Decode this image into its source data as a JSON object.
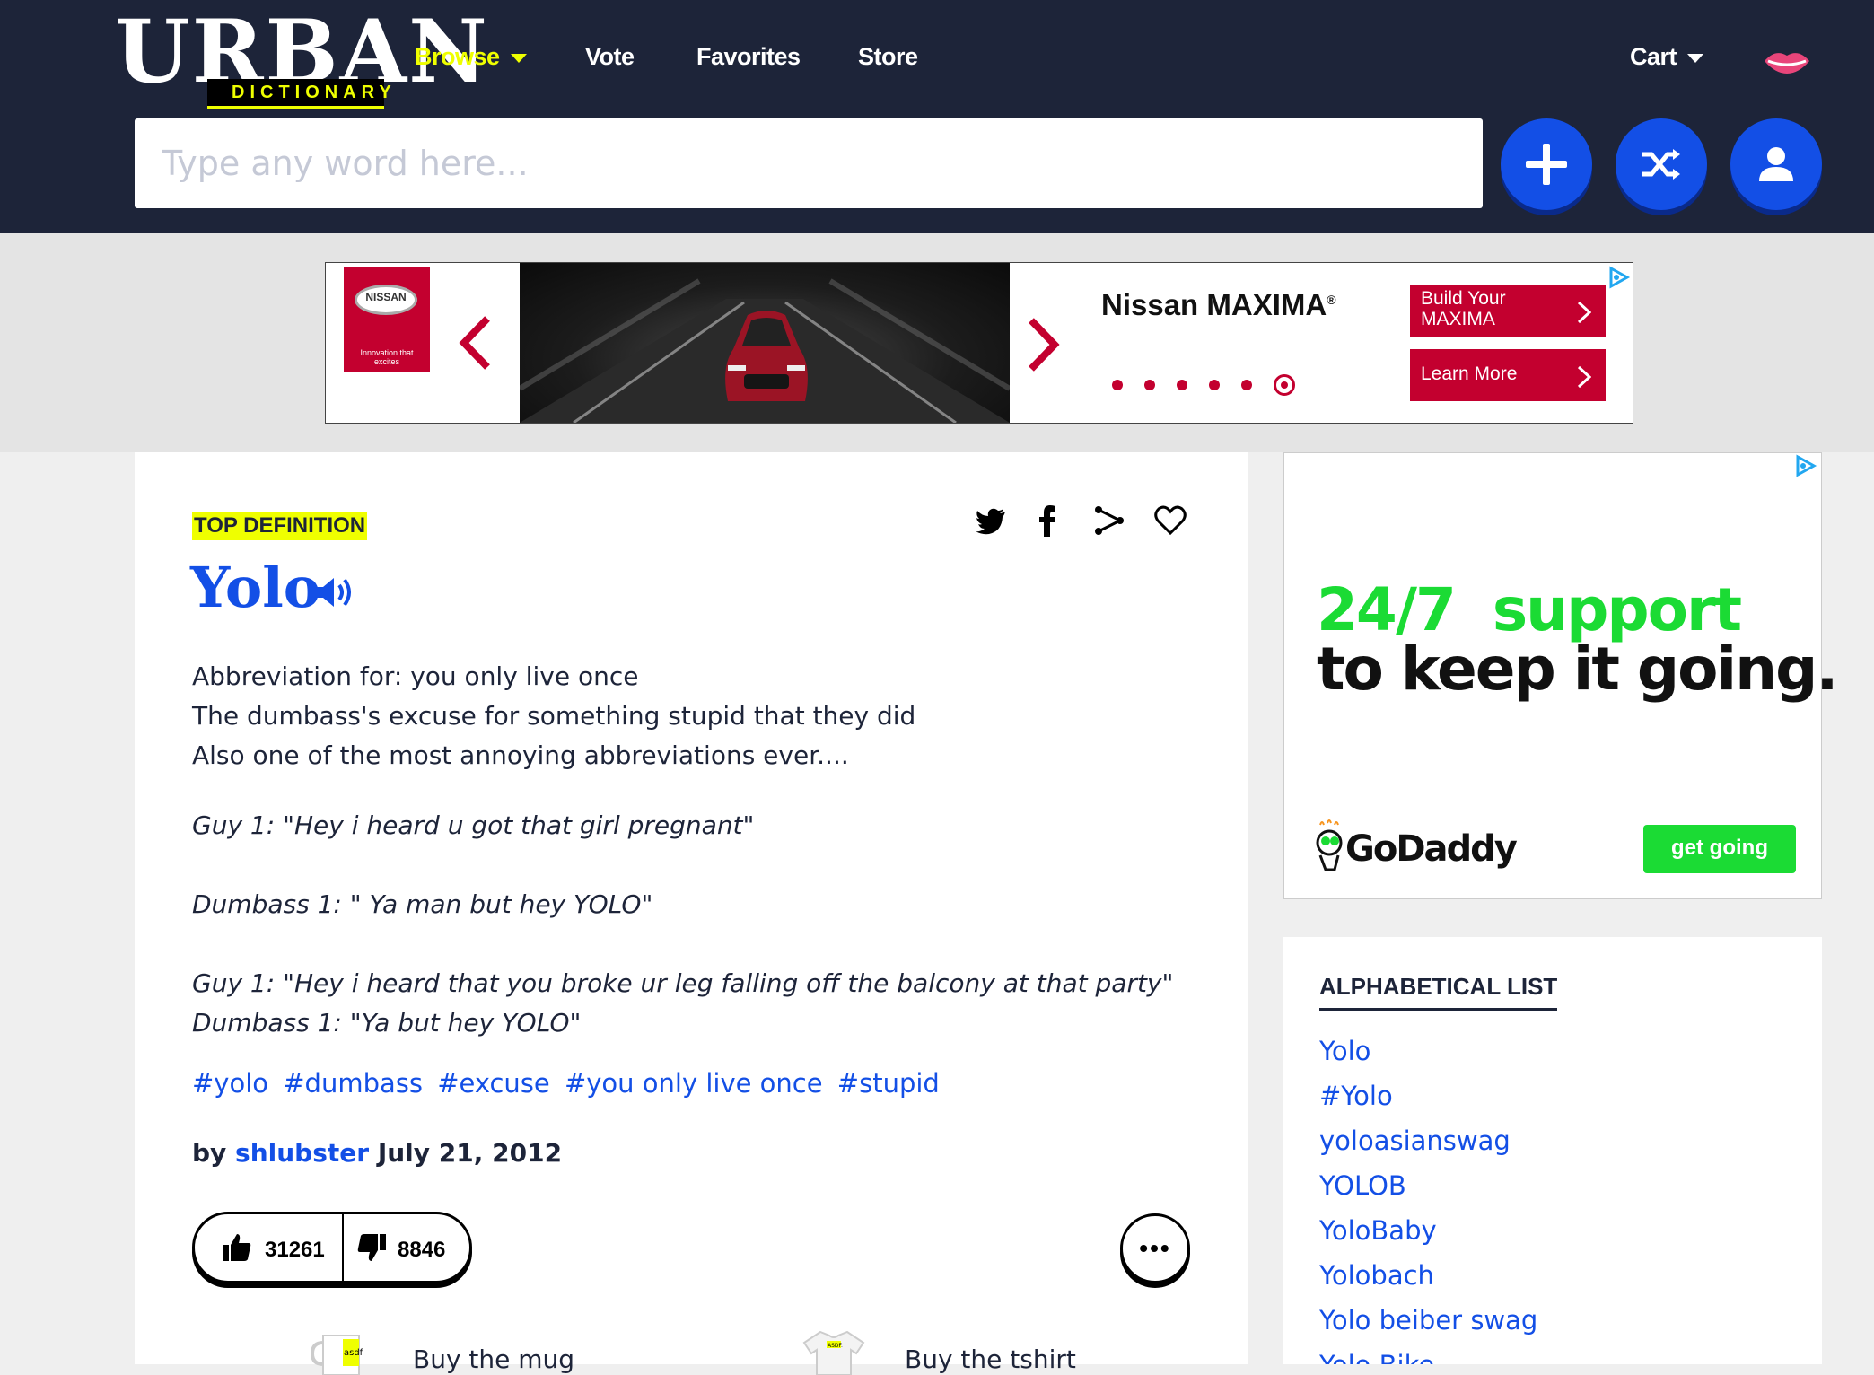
{
  "header": {
    "logo_word": "URBAN",
    "logo_sub": "DICTIONARY",
    "nav": {
      "browse": "Browse",
      "vote": "Vote",
      "favorites": "Favorites",
      "store": "Store",
      "cart": "Cart"
    },
    "search_placeholder": "Type any word here...",
    "colors": {
      "bg": "#1d2439",
      "accent": "#efff00",
      "blue": "#134fe6"
    }
  },
  "ad_banner": {
    "brand_logo": "NISSAN",
    "brand_tagline": "Innovation that excites",
    "title": "Nissan MAXIMA",
    "title_mark": "®",
    "button1": "Build Your MAXIMA",
    "button2": "Learn More",
    "carousel_total": 6,
    "carousel_active": 6,
    "color": "#c3002f"
  },
  "definition": {
    "badge": "TOP DEFINITION",
    "word": "Yolo",
    "meaning_lines": [
      "Abbreviation for: you only live once",
      "The dumbass's excuse for something stupid that they did",
      "Also one of the most annoying abbreviations ever...."
    ],
    "example_lines": [
      "Guy 1: \"Hey i heard u got that girl pregnant\"",
      "",
      "Dumbass 1: \" Ya man but hey YOLO\"",
      "",
      "Guy 1: \"Hey i heard that you broke ur leg falling off the balcony at that party\"",
      "Dumbass 1: \"Ya but hey YOLO\""
    ],
    "tags": [
      "#yolo",
      "#dumbass",
      "#excuse",
      "#you only live once",
      "#stupid"
    ],
    "by_prefix": "by",
    "author": "shlubster",
    "date": "July 21, 2012",
    "upvotes": "31261",
    "downvotes": "8846",
    "more_label": "•••",
    "merch": {
      "mug": "Buy the mug",
      "shirt": "Buy the tshirt",
      "mug_print": "asdf",
      "shirt_print": "ASDF."
    }
  },
  "side_ad": {
    "line1_a": "24/7",
    "line1_b": "support",
    "line2": "to keep it going.",
    "brand": "GoDaddy",
    "button": "get going",
    "color": "#1bdb34"
  },
  "alphabetical": {
    "title": "ALPHABETICAL LIST",
    "items": [
      "Yolo",
      "#Yolo",
      "yoloasianswag",
      "YOLOB",
      "YoloBaby",
      "Yolobach",
      "Yolo beiber swag",
      "Yolo Bike"
    ]
  }
}
